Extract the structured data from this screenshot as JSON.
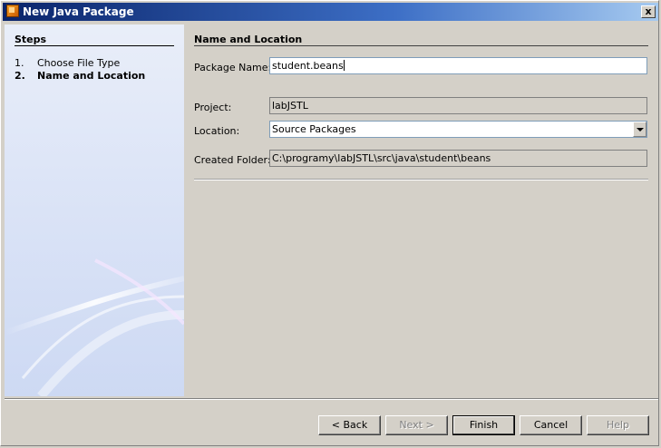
{
  "window": {
    "title": "New Java Package",
    "close_label": "x"
  },
  "steps": {
    "title": "Steps",
    "items": [
      {
        "num": "1.",
        "label": "Choose File Type"
      },
      {
        "num": "2.",
        "label": "Name and Location"
      }
    ]
  },
  "content": {
    "title": "Name and Location",
    "package_name_label": "Package Name:",
    "package_name_value": "student.beans",
    "project_label": "Project:",
    "project_value": "labJSTL",
    "location_label": "Location:",
    "location_value": "Source Packages",
    "created_folder_label": "Created Folder:",
    "created_folder_value": "C:\\programy\\labJSTL\\src\\java\\student\\beans"
  },
  "buttons": {
    "back": "< Back",
    "next": "Next >",
    "finish": "Finish",
    "cancel": "Cancel",
    "help": "Help"
  }
}
